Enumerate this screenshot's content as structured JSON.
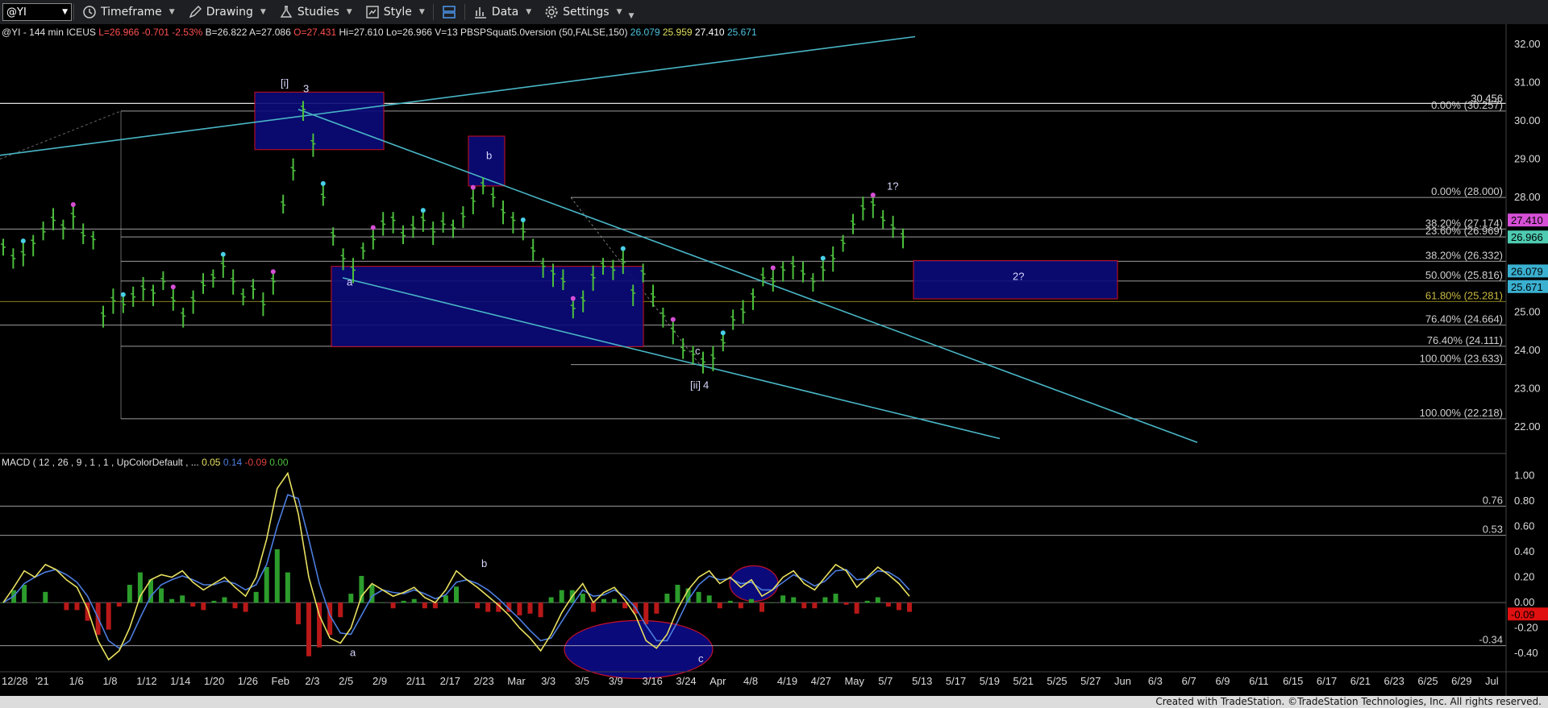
{
  "toolbar": {
    "symbol": "@YI",
    "timeframe_label": "Timeframe",
    "drawing_label": "Drawing",
    "studies_label": "Studies",
    "style_label": "Style",
    "data_label": "Data",
    "settings_label": "Settings"
  },
  "header": {
    "symbol_info": "@YI - 144 min  ICEUS",
    "quote": {
      "last": "L=26.966",
      "change": "-0.701",
      "change_pct": "-2.53%",
      "bid": "B=26.822",
      "ask": "A=27.086",
      "open": "O=27.431",
      "high": "Hi=27.610",
      "low": "Lo=26.966",
      "volume": "V=13"
    },
    "study": "PBSPSquat5.0version (50,FALSE,150)",
    "study_values": [
      "26.079",
      "25.959",
      "27.410",
      "25.671"
    ],
    "study_colors": [
      "#4fc3e0",
      "#e0e060",
      "#ffffff",
      "#4fc3e0"
    ]
  },
  "colors": {
    "background": "#000000",
    "price_axis_bg": "#000000",
    "fib_line": "#d0d0d0",
    "trend_line": "#49b6c6",
    "box_fill": "#0a0a7a",
    "box_border": "#c01028",
    "bar_up": "#4cbf3c",
    "macd_line": "#e8e060",
    "signal_line": "#4d7de0",
    "hist_pos": "#2c9c2c",
    "hist_neg": "#b81818",
    "last_price_tag": "#4ecbb0",
    "magenta_tag": "#d64fd6",
    "neg_tag": "#e01010"
  },
  "chart_data": [
    {
      "type": "line",
      "title": "",
      "ylim": [
        21.5,
        32.4
      ],
      "y_ticks": [
        "32.00",
        "31.00",
        "30.00",
        "29.00",
        "28.00",
        "27.00",
        "26.00",
        "25.00",
        "24.00",
        "23.00",
        "22.00"
      ],
      "x_ticks": [
        "12/28",
        "'21",
        "1/6",
        "1/8",
        "1/12",
        "1/14",
        "1/20",
        "1/26",
        "Feb",
        "2/3",
        "2/5",
        "2/9",
        "2/11",
        "2/17",
        "2/23",
        "Mar",
        "3/3",
        "3/5",
        "3/9",
        "3/16",
        "3/24",
        "Apr",
        "4/8",
        "4/19",
        "4/27",
        "May",
        "5/7",
        "5/13",
        "5/17",
        "5/19",
        "5/21",
        "5/25",
        "5/27",
        "Jun",
        "6/3",
        "6/7",
        "6/9",
        "6/11",
        "6/15",
        "6/17",
        "6/21",
        "6/23",
        "6/25",
        "6/29",
        "Jul"
      ],
      "series": [
        {
          "values": [
            26.7,
            26.4,
            26.5,
            26.8,
            27.1,
            27.4,
            27.2,
            27.5,
            27.0,
            26.9,
            24.9,
            25.3,
            25.2,
            25.4,
            25.6,
            25.5,
            25.8,
            25.3,
            24.9,
            25.3,
            25.7,
            25.9,
            26.2,
            25.8,
            25.4,
            25.6,
            25.2,
            25.8,
            27.8,
            28.7,
            30.3,
            29.4,
            28.0,
            27.0,
            26.4,
            26.1,
            26.6,
            26.9,
            27.3,
            27.4,
            27.0,
            27.2,
            27.4,
            27.1,
            27.3,
            27.2,
            27.5,
            27.9,
            28.3,
            28.0,
            27.6,
            27.4,
            27.1,
            26.6,
            26.2,
            26.0,
            25.8,
            25.1,
            25.3,
            25.9,
            26.2,
            26.1,
            26.3,
            25.5,
            26.0,
            25.4,
            24.9,
            24.5,
            24.0,
            23.9,
            23.7,
            23.8,
            24.2,
            24.8,
            25.0,
            25.4,
            25.9,
            25.8,
            26.1,
            26.2,
            26.0,
            25.8,
            26.1,
            26.4,
            26.8,
            27.3,
            27.7,
            27.8,
            27.4,
            27.2,
            26.97
          ]
        }
      ],
      "fib_levels": [
        {
          "label": "0.00% (30.257)",
          "value": 30.257
        },
        {
          "label": "0.00% (28.000)",
          "value": 28.0
        },
        {
          "label": "38.20% (27.174)",
          "value": 27.174
        },
        {
          "label": "23.60% (26.969)",
          "value": 26.969
        },
        {
          "label": "38.20% (26.332)",
          "value": 26.332
        },
        {
          "label": "50.00% (25.816)",
          "value": 25.816
        },
        {
          "label": "61.80% (25.281)",
          "value": 25.281
        },
        {
          "label": "76.40% (24.664)",
          "value": 24.664
        },
        {
          "label": "76.40% (24.111)",
          "value": 24.111
        },
        {
          "label": "100.00% (23.633)",
          "value": 23.633
        },
        {
          "label": "100.00% (22.218)",
          "value": 22.218
        }
      ],
      "top_level": {
        "label": "30.456",
        "value": 30.456
      },
      "price_tags": [
        {
          "label": "27.410",
          "value": 27.41,
          "color": "#d64fd6"
        },
        {
          "label": "26.966",
          "value": 26.966,
          "color": "#4ecbb0"
        },
        {
          "label": "26.079",
          "value": 26.079,
          "color": "#3ab0d0"
        },
        {
          "label": "25.671",
          "value": 25.671,
          "color": "#3ab0d0"
        }
      ],
      "annotations": [
        "[i]",
        "3",
        "b",
        "1?",
        "a",
        "c",
        "[ii]",
        "4",
        "2?"
      ]
    },
    {
      "type": "line",
      "title": "MACD ( 12 , 26 , 9 , 1 , 1 , UpColorDefault , ...",
      "legend_values": [
        "0.05",
        "0.14",
        "-0.09",
        "0.00"
      ],
      "legend_colors": [
        "#e8e060",
        "#4d7de0",
        "#e04040",
        "#4cbf3c"
      ],
      "ylim": [
        -0.52,
        1.08
      ],
      "y_ticks": [
        "1.00",
        "0.80",
        "0.60",
        "0.40",
        "0.20",
        "0.00",
        "-0.20",
        "-0.40"
      ],
      "ref_levels": [
        {
          "label": "0.76",
          "value": 0.76
        },
        {
          "label": "0.53",
          "value": 0.53
        },
        {
          "label": "-0.34",
          "value": -0.34
        }
      ],
      "last_tag": {
        "label": "-0.09",
        "value": -0.09
      },
      "annotations": [
        "b",
        "a",
        "c"
      ],
      "series": [
        {
          "name": "MACD",
          "values": [
            0.0,
            0.12,
            0.25,
            0.2,
            0.3,
            0.26,
            0.18,
            0.12,
            -0.05,
            -0.3,
            -0.45,
            -0.38,
            -0.2,
            0.05,
            0.18,
            0.22,
            0.2,
            0.25,
            0.16,
            0.1,
            0.15,
            0.2,
            0.12,
            0.05,
            0.2,
            0.5,
            0.9,
            1.02,
            0.7,
            0.2,
            -0.1,
            -0.28,
            -0.32,
            -0.2,
            0.05,
            0.15,
            0.1,
            0.05,
            0.08,
            0.12,
            0.04,
            0.0,
            0.1,
            0.25,
            0.18,
            0.12,
            0.05,
            -0.02,
            -0.1,
            -0.2,
            -0.28,
            -0.38,
            -0.25,
            -0.08,
            0.05,
            0.15,
            0.0,
            0.08,
            0.12,
            0.02,
            -0.1,
            -0.3,
            -0.36,
            -0.25,
            -0.05,
            0.1,
            0.2,
            0.25,
            0.15,
            0.2,
            0.12,
            0.18,
            0.05,
            0.1,
            0.2,
            0.25,
            0.15,
            0.1,
            0.2,
            0.3,
            0.25,
            0.12,
            0.2,
            0.28,
            0.22,
            0.15,
            0.05
          ],
          "color": "#e8e060"
        },
        {
          "name": "Signal",
          "values": [
            0.0,
            0.05,
            0.15,
            0.2,
            0.24,
            0.26,
            0.22,
            0.16,
            0.05,
            -0.12,
            -0.3,
            -0.36,
            -0.3,
            -0.12,
            0.05,
            0.14,
            0.18,
            0.21,
            0.18,
            0.14,
            0.14,
            0.17,
            0.15,
            0.1,
            0.14,
            0.3,
            0.6,
            0.85,
            0.82,
            0.5,
            0.15,
            -0.1,
            -0.24,
            -0.25,
            -0.1,
            0.05,
            0.1,
            0.08,
            0.07,
            0.1,
            0.07,
            0.03,
            0.06,
            0.16,
            0.18,
            0.15,
            0.1,
            0.03,
            -0.05,
            -0.13,
            -0.22,
            -0.3,
            -0.28,
            -0.15,
            -0.02,
            0.1,
            0.05,
            0.06,
            0.1,
            0.05,
            -0.04,
            -0.18,
            -0.3,
            -0.3,
            -0.15,
            0.02,
            0.14,
            0.21,
            0.18,
            0.19,
            0.15,
            0.16,
            0.1,
            0.1,
            0.16,
            0.22,
            0.18,
            0.13,
            0.17,
            0.25,
            0.26,
            0.18,
            0.19,
            0.25,
            0.24,
            0.19,
            0.1
          ],
          "color": "#4d7de0"
        }
      ]
    }
  ],
  "footer": {
    "credit": "Created with TradeStation. ©TradeStation Technologies, Inc. All rights reserved."
  }
}
